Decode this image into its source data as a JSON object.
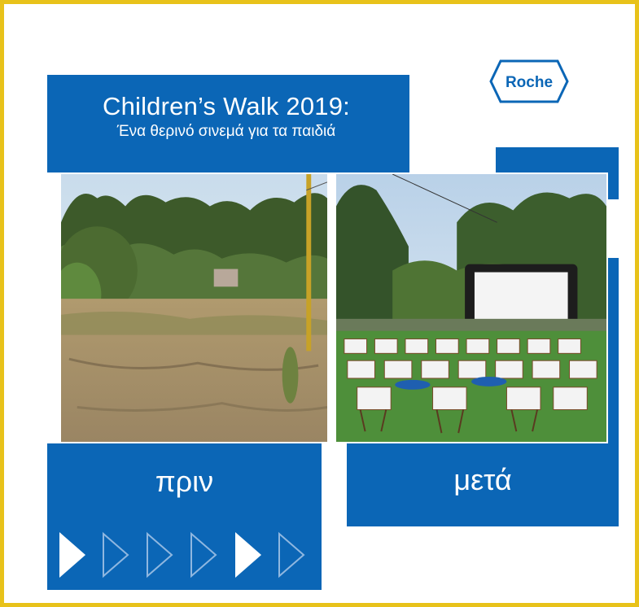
{
  "poster": {
    "title_line1": "Children’s Walk 2019:",
    "title_line2": "Ένα θερινό σινεμά για τα παιδιά",
    "logo_text": "Roche",
    "before_label": "πριν",
    "after_label": "μετά",
    "arrows": [
      "filled",
      "outline",
      "outline",
      "outline",
      "filled",
      "outline"
    ]
  },
  "colors": {
    "frame": "#e8c21a",
    "brand_blue": "#0b66b6",
    "background": "#ffffff"
  }
}
